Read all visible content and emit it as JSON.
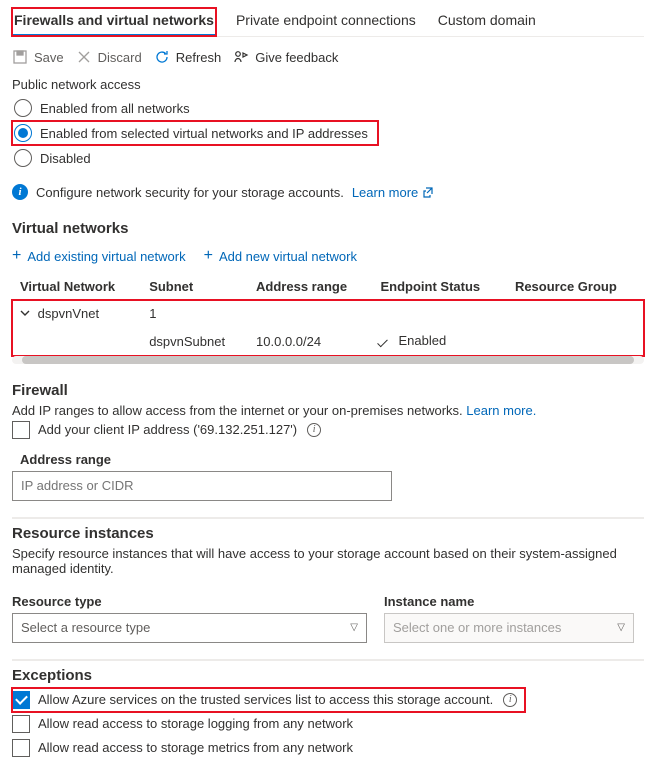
{
  "tabs": {
    "firewalls": "Firewalls and virtual networks",
    "private_endpoints": "Private endpoint connections",
    "custom_domain": "Custom domain"
  },
  "toolbar": {
    "save": "Save",
    "discard": "Discard",
    "refresh": "Refresh",
    "feedback": "Give feedback"
  },
  "public_access": {
    "title": "Public network access",
    "all": "Enabled from all networks",
    "selected": "Enabled from selected virtual networks and IP addresses",
    "disabled": "Disabled",
    "info_text": "Configure network security for your storage accounts.",
    "learn_more": "Learn more"
  },
  "vnets": {
    "title": "Virtual networks",
    "add_existing": "Add existing virtual network",
    "add_new": "Add new virtual network",
    "cols": {
      "vnet": "Virtual Network",
      "subnet": "Subnet",
      "range": "Address range",
      "status": "Endpoint Status",
      "rg": "Resource Group"
    },
    "row_vnet": {
      "name": "dspvnVnet",
      "subnet_count": "1"
    },
    "row_subnet": {
      "name": "dspvnSubnet",
      "range": "10.0.0.0/24",
      "status": "Enabled"
    }
  },
  "firewall": {
    "title": "Firewall",
    "desc": "Add IP ranges to allow access from the internet or your on-premises networks.",
    "learn_more": "Learn more.",
    "add_client_ip_label": "Add your client IP address ('69.132.251.127')",
    "range_label": "Address range",
    "placeholder": "IP address or CIDR"
  },
  "instances": {
    "title": "Resource instances",
    "desc": "Specify resource instances that will have access to your storage account based on their system-assigned managed identity.",
    "type_label": "Resource type",
    "name_label": "Instance name",
    "type_placeholder": "Select a resource type",
    "name_placeholder": "Select one or more instances"
  },
  "exceptions": {
    "title": "Exceptions",
    "trusted": "Allow Azure services on the trusted services list to access this storage account.",
    "logging": "Allow read access to storage logging from any network",
    "metrics": "Allow read access to storage metrics from any network"
  }
}
